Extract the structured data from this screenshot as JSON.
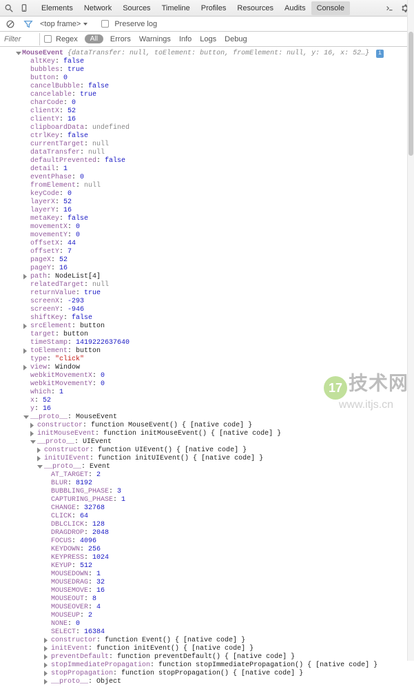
{
  "toolbar": {
    "tabs": [
      "Elements",
      "Network",
      "Sources",
      "Timeline",
      "Profiles",
      "Resources",
      "Audits",
      "Console"
    ],
    "active_tab": "Console"
  },
  "subbar": {
    "frame": "<top frame>",
    "preserve_log": "Preserve log"
  },
  "filterbar": {
    "placeholder": "Filter",
    "regex": "Regex",
    "all": "All",
    "levels": [
      "Errors",
      "Warnings",
      "Info",
      "Logs",
      "Debug"
    ]
  },
  "obj_header": {
    "name": "MouseEvent",
    "summary": "{dataTransfer: null, toElement: button, fromElement: null, y: 16, x: 52…}",
    "badge": "i"
  },
  "props": [
    {
      "k": "altKey",
      "t": "bool",
      "v": "false"
    },
    {
      "k": "bubbles",
      "t": "bool",
      "v": "true"
    },
    {
      "k": "button",
      "t": "num",
      "v": "0"
    },
    {
      "k": "cancelBubble",
      "t": "bool",
      "v": "false"
    },
    {
      "k": "cancelable",
      "t": "bool",
      "v": "true"
    },
    {
      "k": "charCode",
      "t": "num",
      "v": "0"
    },
    {
      "k": "clientX",
      "t": "num",
      "v": "52"
    },
    {
      "k": "clientY",
      "t": "num",
      "v": "16"
    },
    {
      "k": "clipboardData",
      "t": "undef",
      "v": "undefined"
    },
    {
      "k": "ctrlKey",
      "t": "bool",
      "v": "false"
    },
    {
      "k": "currentTarget",
      "t": "null",
      "v": "null"
    },
    {
      "k": "dataTransfer",
      "t": "null",
      "v": "null"
    },
    {
      "k": "defaultPrevented",
      "t": "bool",
      "v": "false"
    },
    {
      "k": "detail",
      "t": "num",
      "v": "1"
    },
    {
      "k": "eventPhase",
      "t": "num",
      "v": "0"
    },
    {
      "k": "fromElement",
      "t": "null",
      "v": "null"
    },
    {
      "k": "keyCode",
      "t": "num",
      "v": "0"
    },
    {
      "k": "layerX",
      "t": "num",
      "v": "52"
    },
    {
      "k": "layerY",
      "t": "num",
      "v": "16"
    },
    {
      "k": "metaKey",
      "t": "bool",
      "v": "false"
    },
    {
      "k": "movementX",
      "t": "num",
      "v": "0"
    },
    {
      "k": "movementY",
      "t": "num",
      "v": "0"
    },
    {
      "k": "offsetX",
      "t": "num",
      "v": "44"
    },
    {
      "k": "offsetY",
      "t": "num",
      "v": "7"
    },
    {
      "k": "pageX",
      "t": "num",
      "v": "52"
    },
    {
      "k": "pageY",
      "t": "num",
      "v": "16"
    },
    {
      "k": "path",
      "t": "obj",
      "v": "NodeList[4]",
      "arrow": "r"
    },
    {
      "k": "relatedTarget",
      "t": "null",
      "v": "null"
    },
    {
      "k": "returnValue",
      "t": "bool",
      "v": "true"
    },
    {
      "k": "screenX",
      "t": "num",
      "v": "-293"
    },
    {
      "k": "screenY",
      "t": "num",
      "v": "-946"
    },
    {
      "k": "shiftKey",
      "t": "bool",
      "v": "false"
    },
    {
      "k": "srcElement",
      "t": "obj",
      "v": "button",
      "arrow": "r"
    },
    {
      "k": "target",
      "t": "obj",
      "v": "button"
    },
    {
      "k": "timeStamp",
      "t": "num",
      "v": "1419222637640"
    },
    {
      "k": "toElement",
      "t": "obj",
      "v": "button",
      "arrow": "r"
    },
    {
      "k": "type",
      "t": "str",
      "v": "\"click\""
    },
    {
      "k": "view",
      "t": "obj",
      "v": "Window",
      "arrow": "r"
    },
    {
      "k": "webkitMovementX",
      "t": "num",
      "v": "0"
    },
    {
      "k": "webkitMovementY",
      "t": "num",
      "v": "0"
    },
    {
      "k": "which",
      "t": "num",
      "v": "1"
    },
    {
      "k": "x",
      "t": "num",
      "v": "52"
    },
    {
      "k": "y",
      "t": "num",
      "v": "16"
    }
  ],
  "proto1": {
    "label": "__proto__",
    "name": "MouseEvent",
    "fns": [
      {
        "k": "constructor",
        "v": "function MouseEvent() { [native code] }"
      },
      {
        "k": "initMouseEvent",
        "v": "function initMouseEvent() { [native code] }"
      }
    ]
  },
  "proto2": {
    "label": "__proto__",
    "name": "UIEvent",
    "fns": [
      {
        "k": "constructor",
        "v": "function UIEvent() { [native code] }"
      },
      {
        "k": "initUIEvent",
        "v": "function initUIEvent() { [native code] }"
      }
    ]
  },
  "proto3": {
    "label": "__proto__",
    "name": "Event",
    "consts": [
      {
        "k": "AT_TARGET",
        "v": "2"
      },
      {
        "k": "BLUR",
        "v": "8192"
      },
      {
        "k": "BUBBLING_PHASE",
        "v": "3"
      },
      {
        "k": "CAPTURING_PHASE",
        "v": "1"
      },
      {
        "k": "CHANGE",
        "v": "32768"
      },
      {
        "k": "CLICK",
        "v": "64"
      },
      {
        "k": "DBLCLICK",
        "v": "128"
      },
      {
        "k": "DRAGDROP",
        "v": "2048"
      },
      {
        "k": "FOCUS",
        "v": "4096"
      },
      {
        "k": "KEYDOWN",
        "v": "256"
      },
      {
        "k": "KEYPRESS",
        "v": "1024"
      },
      {
        "k": "KEYUP",
        "v": "512"
      },
      {
        "k": "MOUSEDOWN",
        "v": "1"
      },
      {
        "k": "MOUSEDRAG",
        "v": "32"
      },
      {
        "k": "MOUSEMOVE",
        "v": "16"
      },
      {
        "k": "MOUSEOUT",
        "v": "8"
      },
      {
        "k": "MOUSEOVER",
        "v": "4"
      },
      {
        "k": "MOUSEUP",
        "v": "2"
      },
      {
        "k": "NONE",
        "v": "0"
      },
      {
        "k": "SELECT",
        "v": "16384"
      }
    ],
    "fns": [
      {
        "k": "constructor",
        "v": "function Event() { [native code] }"
      },
      {
        "k": "initEvent",
        "v": "function initEvent() { [native code] }"
      },
      {
        "k": "preventDefault",
        "v": "function preventDefault() { [native code] }"
      },
      {
        "k": "stopImmediatePropagation",
        "v": "function stopImmediatePropagation() { [native code] }"
      },
      {
        "k": "stopPropagation",
        "v": "function stopPropagation() { [native code] }"
      }
    ],
    "tail": {
      "label": "__proto__",
      "name": "Object"
    }
  },
  "watermark": {
    "num": "17",
    "zh": "技术网",
    "url": "www.itjs.cn"
  }
}
